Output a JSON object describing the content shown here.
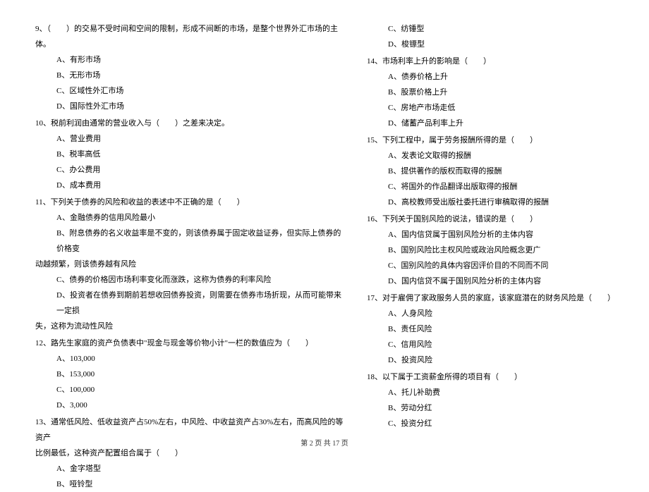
{
  "left": {
    "q9": {
      "text": "9、（　　）的交易不受时间和空间的限制，形成不间断的市场，是整个世界外汇市场的主体。",
      "a": "A、有形市场",
      "b": "B、无形市场",
      "c": "C、区域性外汇市场",
      "d": "D、国际性外汇市场"
    },
    "q10": {
      "text": "10、税前利润由通常的营业收入与（　　）之差来决定。",
      "a": "A、营业费用",
      "b": "B、税率高低",
      "c": "C、办公费用",
      "d": "D、成本费用"
    },
    "q11": {
      "text": "11、下列关于债券的风险和收益的表述中不正确的是（　　）",
      "a": "A、金融债券的信用风险最小",
      "b1": "B、附息债券的名义收益率是不变的，则该债券属于固定收益证券，但实际上债券的价格变",
      "b2": "动越频繁，则该债券越有风险",
      "c": "C、债券的价格因市场利率变化而涨跌，这称为债券的利率风险",
      "d1": "D、投资者在债券到期前若想收回债券投资，则需要在债券市场折现，从而可能带来一定损",
      "d2": "失，这称为流动性风险"
    },
    "q12": {
      "text": "12、路先生家庭的资产负债表中\"现金与现金等价物小计\"一栏的数值应为（　　）",
      "a": "A、103,000",
      "b": "B、153,000",
      "c": "C、100,000",
      "d": "D、3,000"
    },
    "q13": {
      "text1": "13、通常低风险、低收益资产占50%左右，中风险、中收益资产占30%左右，而高风险的等资产",
      "text2": "比例最低，这种资产配置组合属于（　　）",
      "a": "A、金字塔型",
      "b": "B、哑铃型"
    }
  },
  "right": {
    "q13cont": {
      "c": "C、纺锤型",
      "d": "D、梭镖型"
    },
    "q14": {
      "text": "14、市场利率上升的影响是（　　）",
      "a": "A、债券价格上升",
      "b": "B、股票价格上升",
      "c": "C、房地产市场走低",
      "d": "D、储蓄产品利率上升"
    },
    "q15": {
      "text": "15、下列工程中，属于劳务报酬所得的是（　　）",
      "a": "A、发表论文取得的报酬",
      "b": "B、提供著作的版权而取得的报酬",
      "c": "C、将国外的作品翻译出版取得的报酬",
      "d": "D、高校教师受出版社委托进行审稿取得的报酬"
    },
    "q16": {
      "text": "16、下列关于国别风险的说法，错误的是（　　）",
      "a": "A、国内信贷属于国别风险分析的主体内容",
      "b": "B、国别风险比主权风险或政治风险概念更广",
      "c": "C、国别风险的具体内容因评价目的不同而不同",
      "d": "D、国内信贷不属于国别风险分析的主体内容"
    },
    "q17": {
      "text": "17、对于雇佣了家政服务人员的家庭，该家庭潜在的财务风险是（　　）",
      "a": "A、人身风险",
      "b": "B、责任风险",
      "c": "C、信用风险",
      "d": "D、投资风险"
    },
    "q18": {
      "text": "18、以下属于工资薪金所得的项目有（　　）",
      "a": "A、托儿补助费",
      "b": "B、劳动分红",
      "c": "C、投资分红"
    }
  },
  "footer": "第 2 页 共 17 页"
}
